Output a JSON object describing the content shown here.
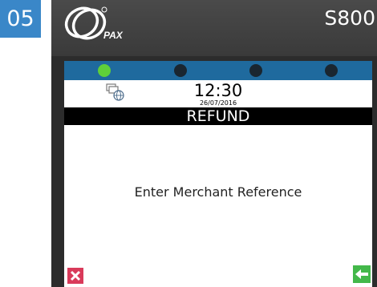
{
  "step": {
    "number": "05",
    "color": "#3a87c8"
  },
  "device": {
    "brand": "PAX",
    "model": "S800"
  },
  "status": {
    "leds": [
      {
        "state": "on",
        "color": "#5fcf3a"
      },
      {
        "state": "off",
        "color": "#1a2630"
      },
      {
        "state": "off",
        "color": "#1a2630"
      },
      {
        "state": "off",
        "color": "#1a2630"
      }
    ],
    "network_icon": "network-globe-icon",
    "time": "12:30",
    "date": "26/07/2016"
  },
  "screen": {
    "title": "REFUND",
    "prompt": "Enter Merchant Reference"
  },
  "keys": {
    "cancel_icon": "cancel-x-icon",
    "cancel_color": "#d93a5a",
    "enter_icon": "enter-arrow-icon",
    "enter_color": "#43b84a"
  }
}
